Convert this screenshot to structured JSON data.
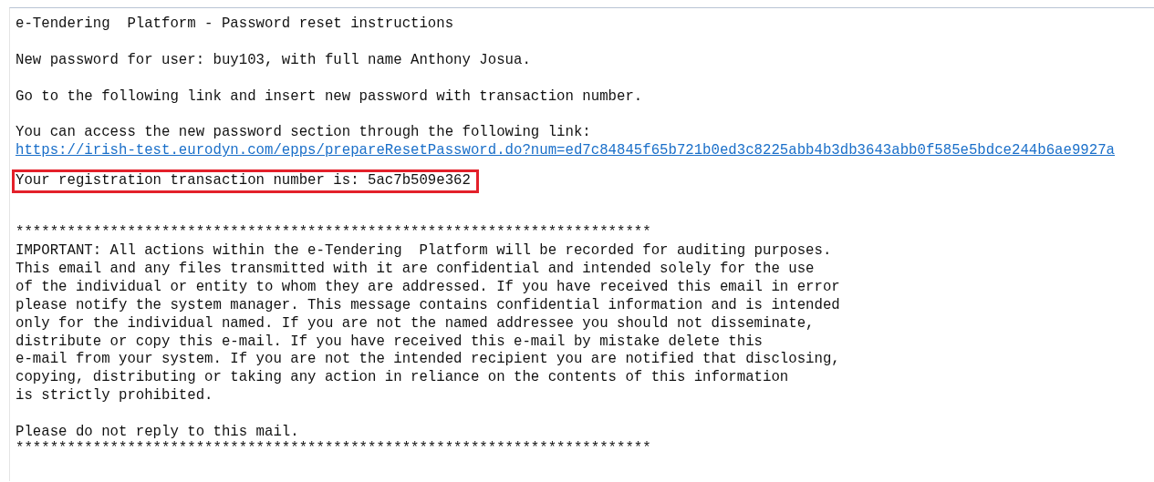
{
  "email": {
    "subject_line": "e-Tendering  Platform - Password reset instructions",
    "user_line": "New password for user: buy103, with full name Anthony Josua.",
    "instruction": "Go to the following link and insert new password with transaction number.",
    "access_text": "You can access the new password section through the following link:",
    "link": "https://irish-test.eurodyn.com/epps/prepareResetPassword.do?num=ed7c84845f65b721b0ed3c8225abb4b3db3643abb0f585e5bdce244b6ae9927a",
    "transaction_line": {
      "text": "Your registration transaction number is: 5ac7b509e362",
      "highlighted": true
    },
    "separator_top": "**************************************************************************",
    "disclaimer": "IMPORTANT: All actions within the e-Tendering  Platform will be recorded for auditing purposes.\nThis email and any files transmitted with it are confidential and intended solely for the use\nof the individual or entity to whom they are addressed. If you have received this email in error\nplease notify the system manager. This message contains confidential information and is intended\nonly for the individual named. If you are not the named addressee you should not disseminate,\ndistribute or copy this e-mail. If you have received this e-mail by mistake delete this\ne-mail from your system. If you are not the intended recipient you are notified that disclosing,\ncopying, distributing or taking any action in reliance on the contents of this information\nis strictly prohibited.",
    "closing": "Please do not reply to this mail.",
    "separator_bottom": "**************************************************************************"
  }
}
